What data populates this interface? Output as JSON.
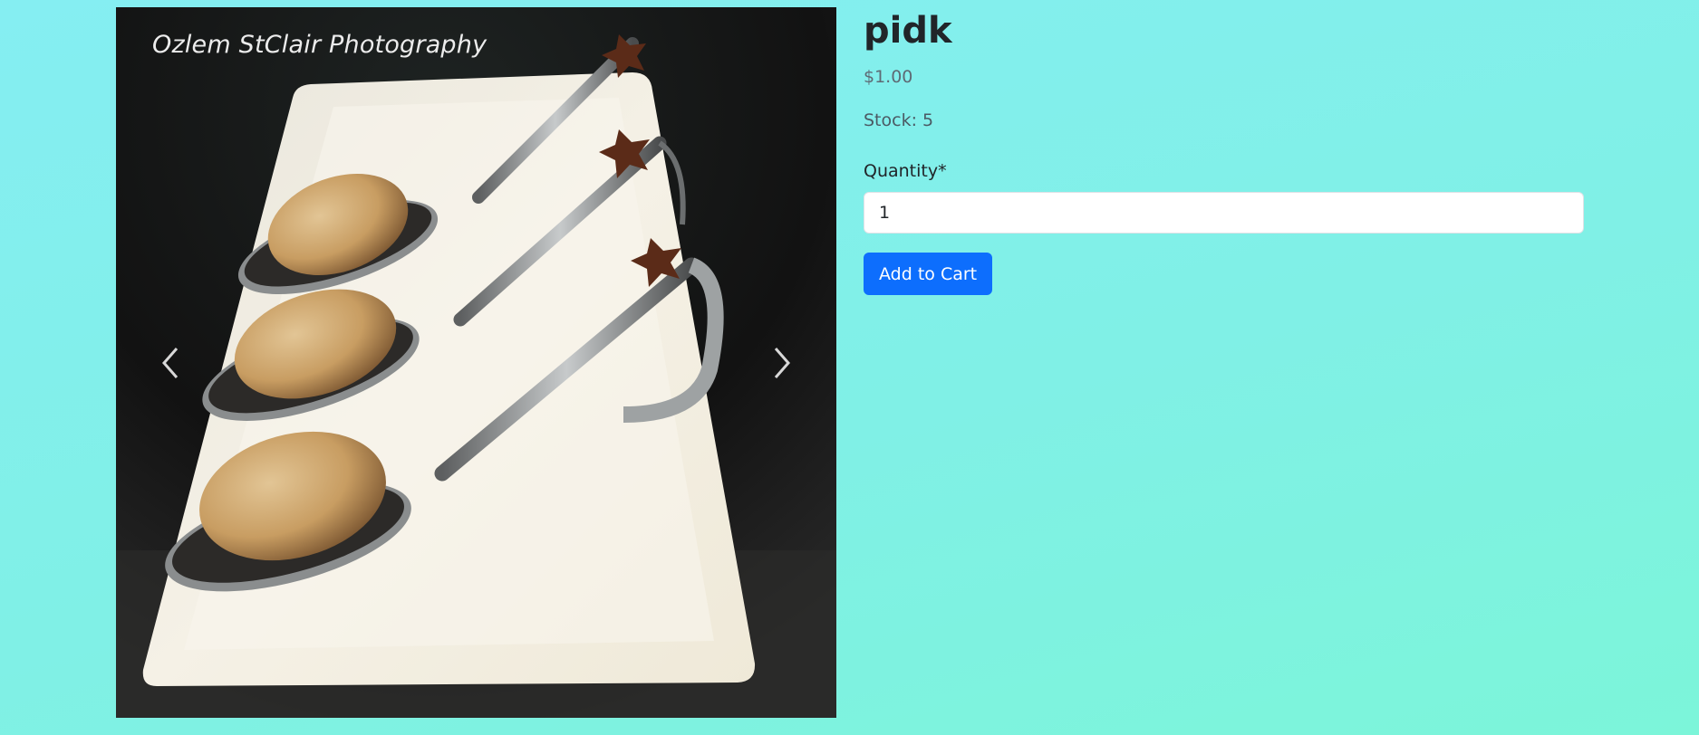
{
  "carousel": {
    "watermark": "Ozlem StClair Photography",
    "prev_icon": "chevron-left-icon",
    "next_icon": "chevron-right-icon"
  },
  "product": {
    "title": "pidk",
    "price": "$1.00",
    "stock": "Stock: 5",
    "quantity_label": "Quantity*",
    "quantity_value": "1",
    "add_to_cart_label": "Add to Cart"
  },
  "colors": {
    "primary": "#0d6efd",
    "background_start": "#85eef2",
    "background_end": "#7cf5d9"
  }
}
